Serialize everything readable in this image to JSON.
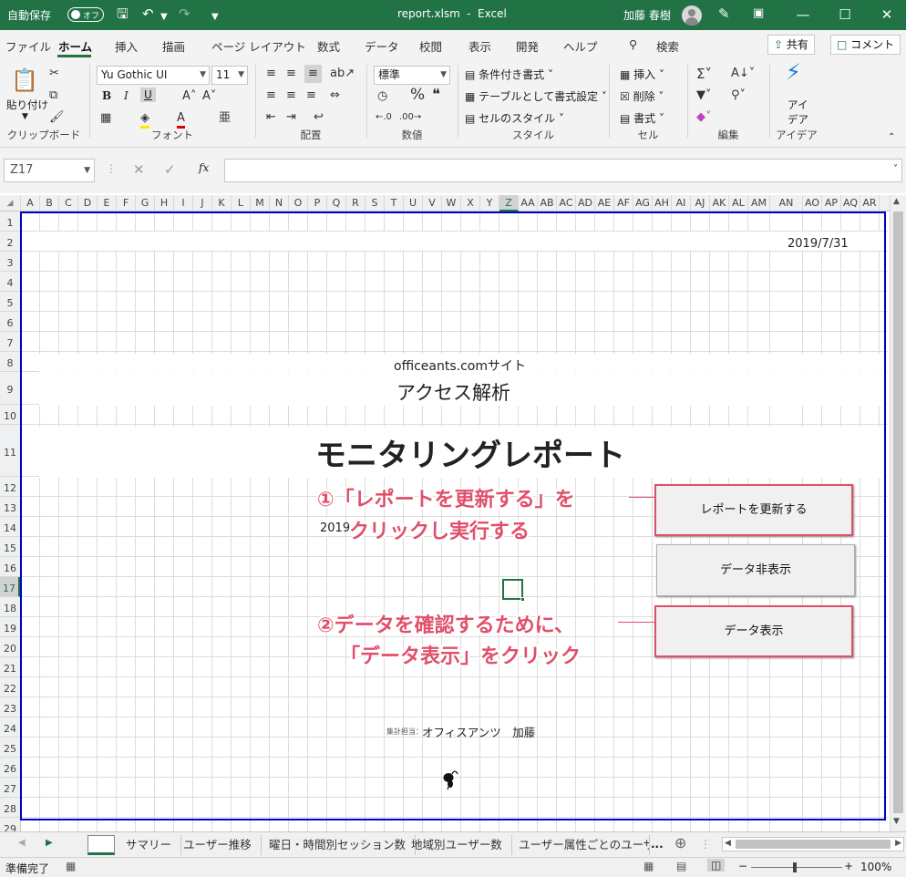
{
  "titlebar": {
    "autosave_label": "自動保存",
    "autosave_state": "オフ",
    "filename": "report.xlsm",
    "sep": "-",
    "app": "Excel",
    "user": "加藤 春樹"
  },
  "menu": {
    "tabs": [
      "ファイル",
      "ホーム",
      "挿入",
      "描画",
      "ページ レイアウト",
      "数式",
      "データ",
      "校閲",
      "表示",
      "開発",
      "ヘルプ"
    ],
    "active": "ホーム",
    "search": "検索",
    "share": "共有",
    "comment": "コメント"
  },
  "ribbon": {
    "clipboard": {
      "paste": "貼り付け",
      "label": "クリップボード"
    },
    "font": {
      "name": "Yu Gothic UI",
      "size": "11",
      "label": "フォント",
      "bold": "B",
      "italic": "I",
      "underline": "U"
    },
    "alignment": {
      "label": "配置"
    },
    "number": {
      "format": "標準",
      "label": "数値"
    },
    "styles": {
      "conditional": "条件付き書式",
      "table": "テーブルとして書式設定",
      "cell": "セルのスタイル",
      "label": "スタイル"
    },
    "cells": {
      "insert": "挿入",
      "delete": "削除",
      "format": "書式",
      "label": "セル"
    },
    "editing": {
      "label": "編集"
    },
    "ideas": {
      "line1": "アイ",
      "line2": "デア",
      "label": "アイデア"
    }
  },
  "formula": {
    "namebox": "Z17",
    "value": ""
  },
  "columns": [
    "A",
    "B",
    "C",
    "D",
    "E",
    "F",
    "G",
    "H",
    "I",
    "J",
    "K",
    "L",
    "M",
    "N",
    "O",
    "P",
    "Q",
    "R",
    "S",
    "T",
    "U",
    "V",
    "W",
    "X",
    "Y",
    "Z",
    "AA",
    "AB",
    "AC",
    "AD",
    "AE",
    "AF",
    "AG",
    "AH",
    "AI",
    "AJ",
    "AK",
    "AL",
    "AM",
    "AN",
    "AO",
    "AP",
    "AQ",
    "AR"
  ],
  "selected_column": "Z",
  "rows": [
    "1",
    "2",
    "3",
    "4",
    "5",
    "6",
    "7",
    "8",
    "9",
    "10",
    "11",
    "12",
    "13",
    "14",
    "15",
    "16",
    "17",
    "18",
    "19",
    "20",
    "21",
    "22",
    "23",
    "24",
    "25",
    "26",
    "27",
    "28",
    "29"
  ],
  "selected_row": "17",
  "sheet": {
    "date": "2019/7/31",
    "site": "officeants.comサイト",
    "subtitle": "アクセス解析",
    "title": "モニタリングレポート",
    "partial_date": "2019",
    "footer_small": "集計担当：",
    "footer_name": "オフィスアンツ　加藤"
  },
  "buttons": {
    "refresh": "レポートを更新する",
    "hide": "データ非表示",
    "show": "データ表示"
  },
  "annotations": {
    "a1_line1": "①「レポートを更新する」を",
    "a1_line2": "クリックし実行する",
    "a2_line1": "②データを確認するために、",
    "a2_line2": "「データ表示」をクリック"
  },
  "colors": {
    "excel_green": "#217346",
    "annotation_pink": "#e0506a",
    "print_border": "#0000c8"
  },
  "sheettabs": {
    "tabs": [
      "",
      "サマリー",
      "ユーザー推移",
      "曜日・時間別セッション数",
      "地域別ユーザー数",
      "ユーザー属性ごとのユーザ-"
    ],
    "active_index": 0,
    "more": "..."
  },
  "status": {
    "ready": "準備完了",
    "zoom": "100%"
  }
}
